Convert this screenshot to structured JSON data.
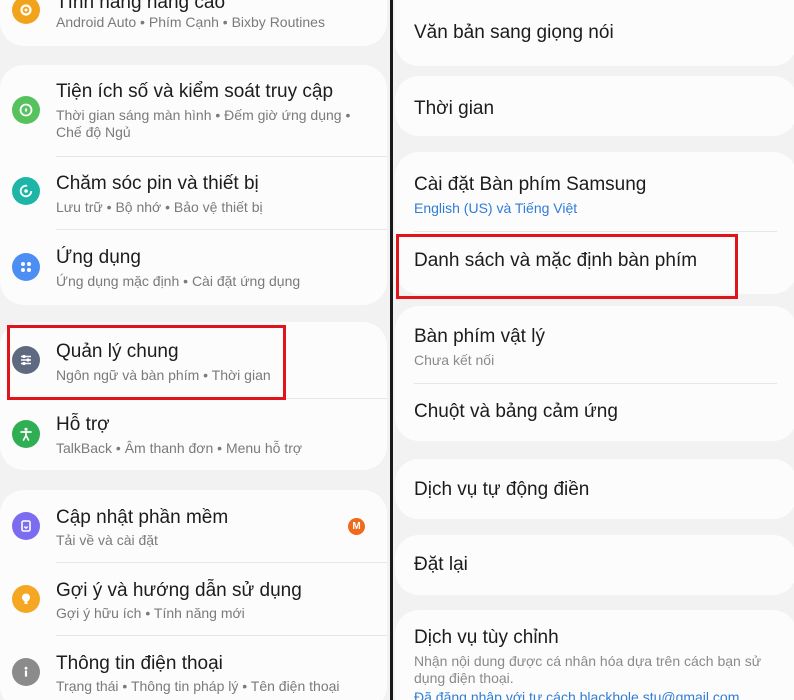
{
  "left": {
    "items": [
      {
        "title": "Tính năng nâng cao",
        "subtitle": "Android Auto  •  Phím Cạnh  •  Bixby Routines",
        "icon": "gear-icon",
        "color": "#f2a31c"
      },
      {
        "title": "Tiện ích số và kiểm soát truy cập",
        "subtitle": "Thời gian sáng màn hình  •  Đếm giờ ứng dụng  •  Chế độ Ngủ",
        "icon": "digital-wellbeing-icon",
        "color": "#55c25e"
      },
      {
        "title": "Chăm sóc pin và thiết bị",
        "subtitle": "Lưu trữ  •  Bộ nhớ  •  Bảo vệ thiết bị",
        "icon": "device-care-icon",
        "color": "#1db6a6"
      },
      {
        "title": "Ứng dụng",
        "subtitle": "Ứng dụng mặc định  •  Cài đặt ứng dụng",
        "icon": "apps-icon",
        "color": "#4d8ef5"
      },
      {
        "title": "Quản lý chung",
        "subtitle": "Ngôn ngữ và bàn phím  •  Thời gian",
        "icon": "sliders-icon",
        "color": "#5d6a80"
      },
      {
        "title": "Hỗ trợ",
        "subtitle": "TalkBack  •  Âm thanh đơn  •  Menu hỗ trợ",
        "icon": "accessibility-icon",
        "color": "#2fae53"
      },
      {
        "title": "Cập nhật phần mềm",
        "subtitle": "Tải về và cài đặt",
        "icon": "software-update-icon",
        "color": "#7b6cf0",
        "badge": "M"
      },
      {
        "title": "Gợi ý và hướng dẫn sử dụng",
        "subtitle": "Gợi ý hữu ích  •  Tính năng mới",
        "icon": "lightbulb-icon",
        "color": "#f5a623"
      },
      {
        "title": "Thông tin điện thoại",
        "subtitle": "Trạng thái  •  Thông tin pháp lý  •  Tên điện thoại",
        "icon": "info-icon",
        "color": "#8b8b8b"
      }
    ]
  },
  "right": {
    "items": [
      {
        "title": "Văn bản sang giọng nói"
      },
      {
        "title": "Thời gian"
      },
      {
        "title": "Cài đặt Bàn phím Samsung",
        "subtitle": "English (US) và Tiếng Việt"
      },
      {
        "title": "Danh sách và mặc định bàn phím"
      },
      {
        "title": "Bàn phím vật lý",
        "subtitle": "Chưa kết nối"
      },
      {
        "title": "Chuột và bảng cảm ứng"
      },
      {
        "title": "Dịch vụ tự động điền"
      },
      {
        "title": "Đặt lại"
      },
      {
        "title": "Dịch vụ tùy chỉnh",
        "subtitle": "Nhận nội dung được cá nhân hóa dựa trên cách bạn sử dụng điện thoại.",
        "subtitle2": "Đã đăng nhập với tư cách blackhole.stu@gmail.com"
      }
    ]
  },
  "highlight_color": "#e0141b"
}
